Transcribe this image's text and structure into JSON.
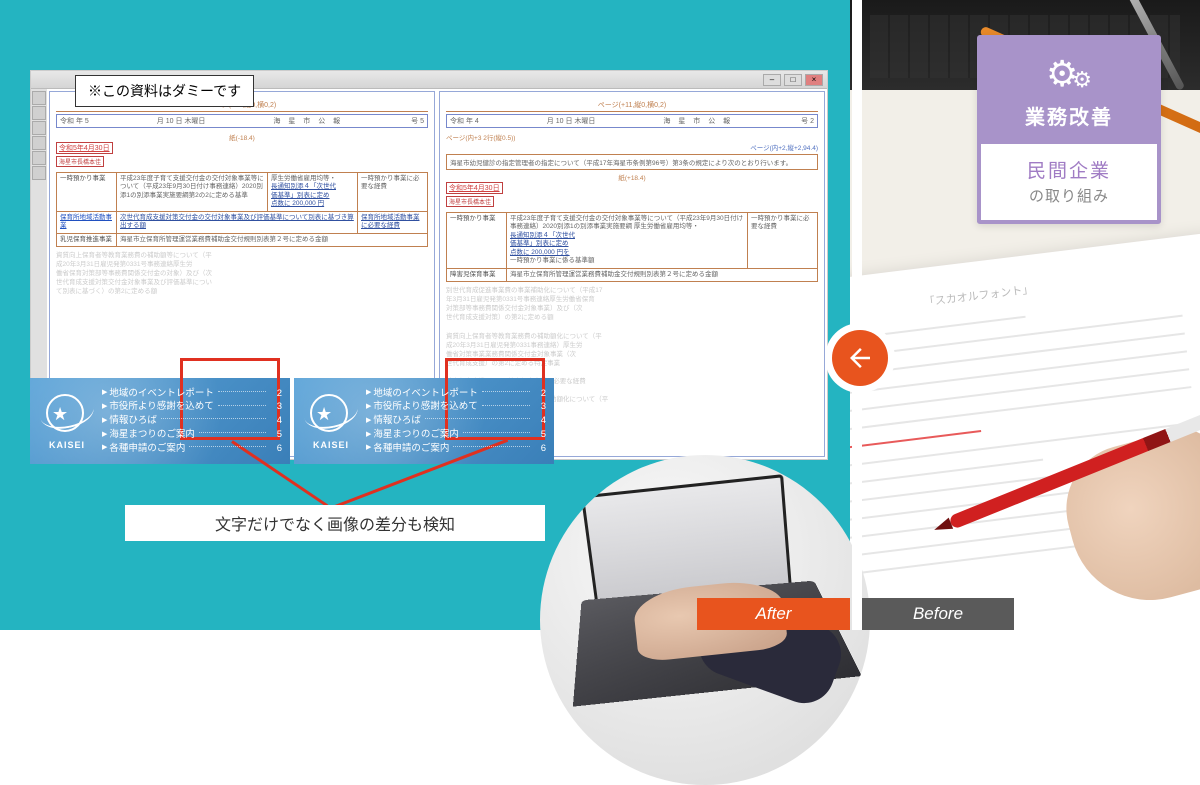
{
  "dummy_note": "※この資料はダミーです",
  "page_left": {
    "header": "ページ(+11,縦0,横0,2)",
    "year": "令和 年 5",
    "date_jp": "月 10 日 木曜日",
    "pub": "海 星 市 公 報",
    "issue": "号 5",
    "redDate": "令和5年4月30日",
    "redSub": "海星市長橋本佳",
    "rows": {
      "r1_label": "一時預かり事業",
      "r1_body_a": "平成23年度子育て支援交付金の交付対象事業等について（平成23年9月30日付け事務連絡）2020別添1の別添事業実施要綱第2の2に定める基準",
      "r1_body_b": "厚生労働省雇用均等・",
      "r1_link": "長通知別添４「次世代",
      "r1_after": "価基準」別表に定め",
      "r1_points": "点数に 200,000 円",
      "r1_right": "一時預かり事業に必要な経費",
      "r2_label": "保育所地域活動事業",
      "r2_body": "次世代育成支援対策交付金の交付対象事業及び評価基準について別表に基づき算出する額",
      "r2_right": "保育所地域活動事業に必要な経費",
      "r3_label": "乳児保育推進事業",
      "r3_body": "海星市立保育所管理運営業務費補助金交付規則別表第２号に定める金額"
    }
  },
  "page_right": {
    "header": "ページ(+11,縦0,横0,2)",
    "year": "令和 年 4",
    "date_jp": "月 10 日 木曜日",
    "pub": "海 星 市 公 報",
    "issue": "号 2",
    "pageNote": "ページ(内+3 2行(縦0.5))",
    "blueNote": "ページ(内+2,縦+2,94.4)",
    "intro": "海星市幼児健診の指定管理者の指定について（平成17年海星市条例第96号）第3条の規定により次のとおり行います。",
    "redDate": "令和5年4月30日",
    "redSub": "海星市長橋本佳",
    "rows": {
      "r1_label": "一時預かり事業",
      "r1_body": "平成23年度子育て支援交付金の交付対象事業等について（平成23年9月30日付け事務連絡）2020別添1の別添事業実施要綱 厚生労働省雇用均等・",
      "r1_link": "長通知別添４「次世代",
      "r1_after": "価基準」別表に定め",
      "r1_points": "点数に 200,000 円を",
      "r1_foot": "一時預かり事業に係る基準額",
      "r1_right": "一時預かり事業に必要な経費",
      "r2_label": "障害児保育事業",
      "r2_body": "海星市立保育所管理運営業務費補助金交付規則別表第２号に定める金額"
    }
  },
  "toc": {
    "logo": "KAISEI",
    "items": [
      {
        "label": "地域のイベントレポート",
        "page": "2"
      },
      {
        "label": "市役所より感謝を込めて",
        "page": "3"
      },
      {
        "label": "情報ひろば",
        "page": "4"
      },
      {
        "label": "海星まつりのご案内",
        "page": "5"
      },
      {
        "label": "各種申請のご案内",
        "page": "6"
      }
    ]
  },
  "caption": "文字だけでなく画像の差分も検知",
  "labels": {
    "after": "After",
    "before": "Before"
  },
  "badge": {
    "title": "業務改善",
    "line1": "民間企業",
    "line2": "の取り組み"
  },
  "paper_heading": "「スカオルフォント」"
}
